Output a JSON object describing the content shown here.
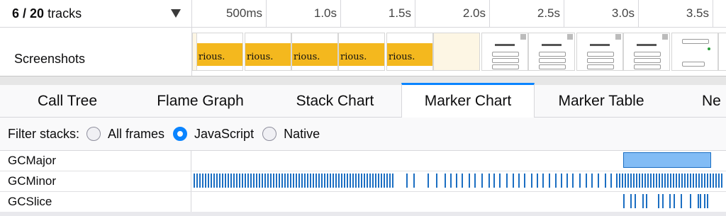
{
  "track_selector": {
    "selected": "6",
    "separator": " / ",
    "total": "20",
    "suffix": " tracks"
  },
  "timeline": {
    "ticks": [
      "500ms",
      "1.0s",
      "1.5s",
      "2.0s",
      "2.5s",
      "3.0s",
      "3.5s"
    ],
    "screenshots_label": "Screenshots",
    "screenshot_word": "rious."
  },
  "tabs": [
    "Call Tree",
    "Flame Graph",
    "Stack Chart",
    "Marker Chart",
    "Marker Table",
    "Ne"
  ],
  "selected_tab": "Marker Chart",
  "filter": {
    "label": "Filter stacks:",
    "options": [
      "All frames",
      "JavaScript",
      "Native"
    ],
    "selected": "JavaScript"
  },
  "markers": {
    "rows": [
      "GCMajor",
      "GCMinor",
      "GCSlice"
    ]
  },
  "colors": {
    "accent": "#0a84ff",
    "marker_fill": "#1b6ec2",
    "major_fill": "#82bcf5",
    "major_border": "#1b6ec2"
  }
}
